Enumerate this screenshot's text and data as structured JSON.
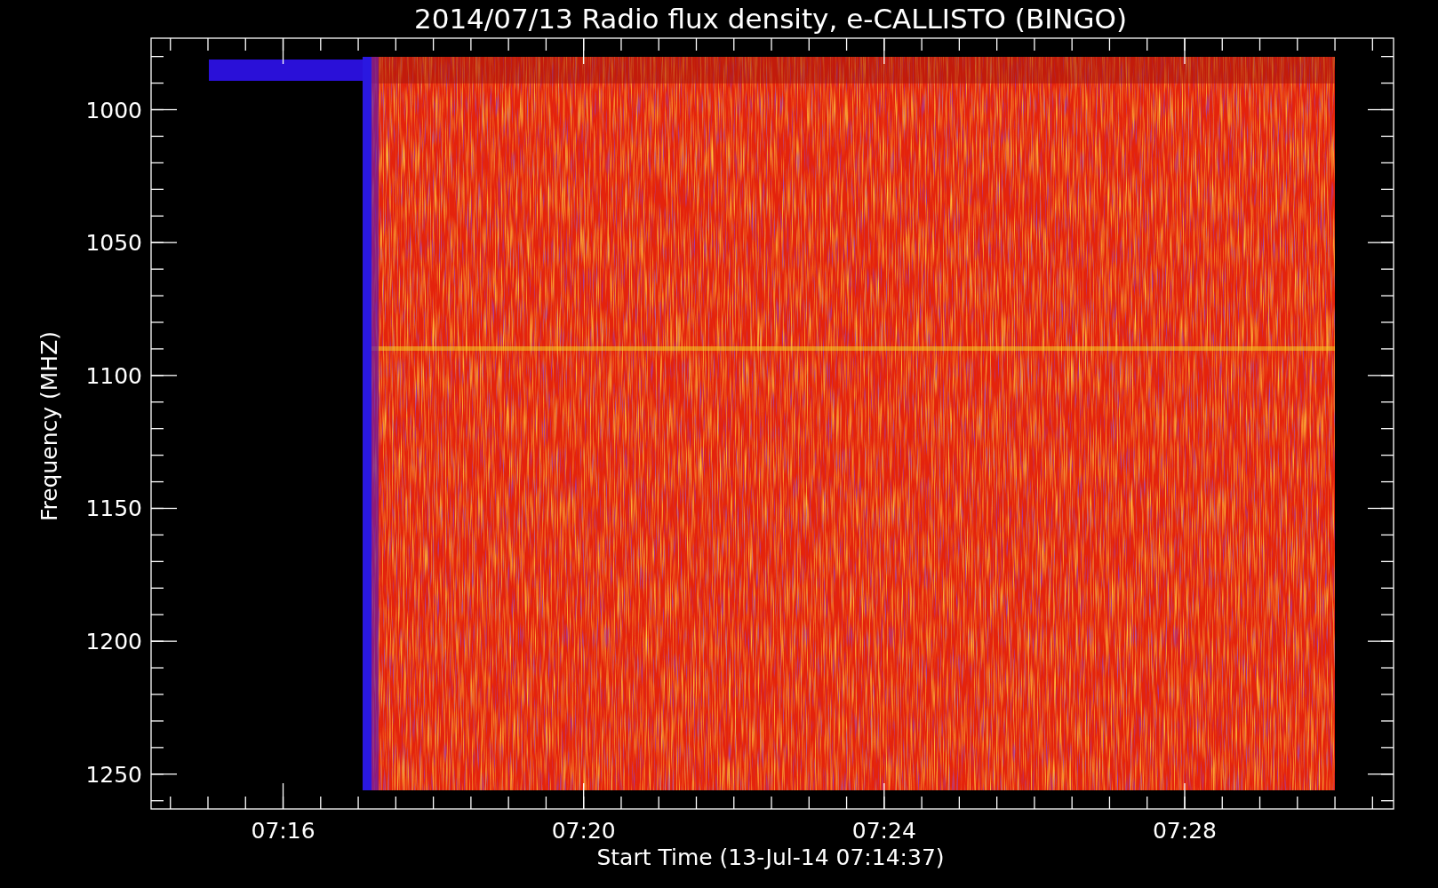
{
  "title": "2014/07/13  Radio flux density, e-CALLISTO (BINGO)",
  "y_axis": {
    "label": "Frequency (MHZ)",
    "ticks": [
      "1000",
      "1050",
      "1100",
      "1150",
      "1200",
      "1250"
    ]
  },
  "x_axis": {
    "label": "Start Time (13-Jul-14 07:14:37)",
    "ticks": [
      "07:16",
      "07:20",
      "07:24",
      "07:28"
    ]
  }
}
